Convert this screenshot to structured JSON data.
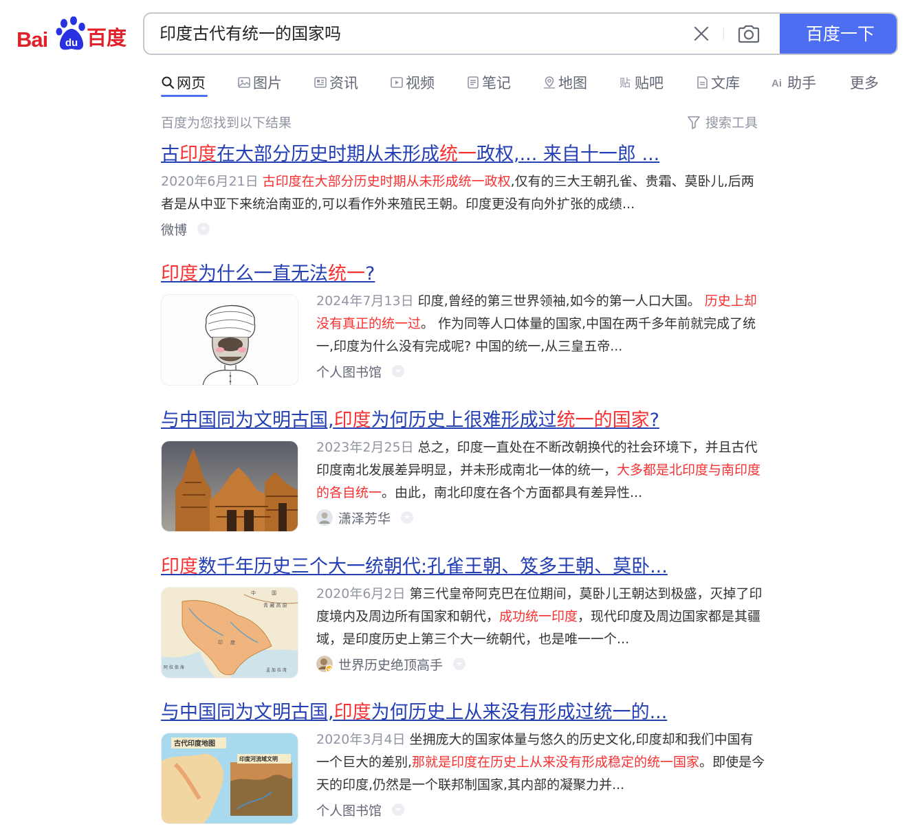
{
  "logo": {
    "brand_latin": "Bai",
    "brand_paw_text": "du",
    "brand_cn": "百度"
  },
  "search": {
    "query": "印度古代有统一的国家吗",
    "button_label": "百度一下"
  },
  "tabs": [
    {
      "label": "网页",
      "icon": "search-icon",
      "active": true
    },
    {
      "label": "图片",
      "icon": "image-icon"
    },
    {
      "label": "资讯",
      "icon": "news-icon"
    },
    {
      "label": "视频",
      "icon": "video-icon"
    },
    {
      "label": "笔记",
      "icon": "note-icon"
    },
    {
      "label": "地图",
      "icon": "map-icon"
    },
    {
      "label": "贴吧",
      "icon": "tieba-icon"
    },
    {
      "label": "文库",
      "icon": "doc-icon"
    },
    {
      "label": "助手",
      "icon": "ai-icon"
    },
    {
      "label": "更多"
    }
  ],
  "result_summary": "百度为您找到以下结果",
  "search_tools_label": "搜索工具",
  "colors": {
    "accent": "#4e6ef2",
    "link": "#2440b3",
    "highlight": "#f73131",
    "meta": "#9195a3"
  },
  "results": [
    {
      "title_parts": [
        "古",
        "印度",
        "在大部分历史时期从未形成",
        "统一",
        "政权,... 来自十一郎 ..."
      ],
      "date": "2020年6月21日",
      "snippet_parts": [
        "古印度在大部分历史时期从未形成统一政权",
        ",仅有的三大王朝孔雀、贵霜、莫卧儿,后两者是从中亚下来统治南亚的,可以看作外来殖民王朝。印度更没有向外扩张的成绩..."
      ],
      "source": "微博"
    },
    {
      "title_parts": [
        "印度",
        "为什么一直无法",
        "统一",
        "?"
      ],
      "date": "2024年7月13日",
      "snippet_parts": [
        "印度,曾经的第三世界领袖,如今的第一人口大国。 ",
        "历史上却没有真正的统一过",
        "。 作为同等人口体量的国家,中国在两千多年前就完成了统一,印度为什么没有完成呢? 中国的统一,从三皇五帝..."
      ],
      "source": "个人图书馆",
      "image": "turban-man-sketch"
    },
    {
      "title_parts": [
        "与中国同为文明古国,",
        "印度",
        "为何历史上很难形成过",
        "统一的国家",
        "?"
      ],
      "date": "2023年2月25日",
      "snippet_parts": [
        "总之，印度一直处在不断改朝换代的社会环境下，并且古代印度南北发展差异明显，并未形成南北一体的统一，",
        "大多都是北印度与南印度的各自统一",
        "。由此，南北印度在各个方面都具有差异性..."
      ],
      "source": "潇泽芳华",
      "image": "indian-temple-photo"
    },
    {
      "title_parts": [
        "印度",
        "数千年历史三个大一统朝代:孔雀王朝、笈多王朝、莫卧..."
      ],
      "date": "2020年6月2日",
      "snippet_parts": [
        "第三代皇帝阿克巴在位期间，莫卧儿王朝达到极盛，灭掉了印度境内及周边所有国家和朝代，",
        "成功统一印度",
        "，现代印度及周边国家都是其疆域，是印度历史上第三个大一统朝代，也是唯一一个..."
      ],
      "source": "世界历史绝顶高手",
      "image": "historical-map-india",
      "map_labels": [
        "中",
        "国",
        "青 藏 高 原",
        "印",
        "度",
        "阿 拉 伯 海",
        "孟 加 拉 湾"
      ]
    },
    {
      "title_parts": [
        "与中国同为文明古国,",
        "印度",
        "为何历史上从来没有形成过统一的..."
      ],
      "date": "2020年3月4日",
      "snippet_parts": [
        "坐拥庞大的国家体量与悠久的历史文化,印度却和我们中国有一个巨大的差别,",
        "那就是印度在历史上从来没有形成稳定的统一国家",
        "。即使是今天的印度,仍然是一个联邦制国家,其内部的凝聚力并..."
      ],
      "source": "个人图书馆",
      "image": "ancient-india-map",
      "map_labels": [
        "古代印度地图",
        "印度河流域文明"
      ]
    }
  ]
}
